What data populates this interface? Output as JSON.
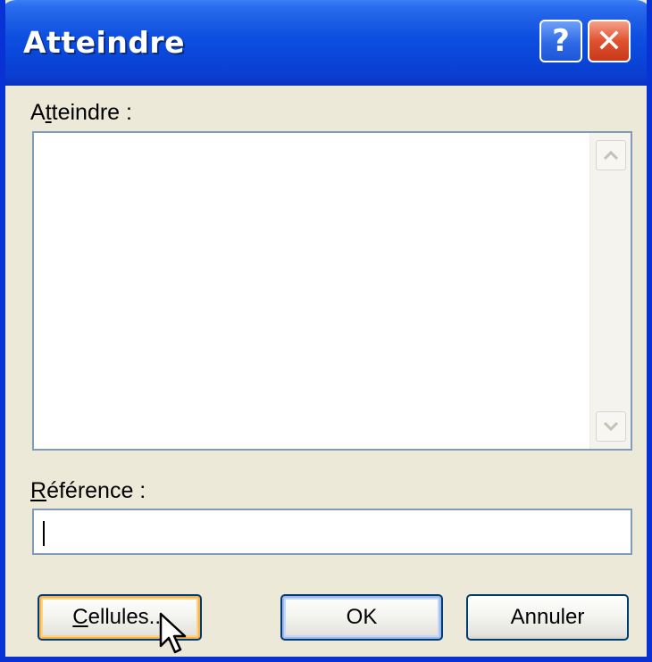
{
  "window": {
    "title": "Atteindre",
    "help_glyph": "?",
    "close_glyph": "✕"
  },
  "goto": {
    "label_prefix": "A",
    "label_accel": "t",
    "label_rest": "teindre :",
    "items": []
  },
  "reference": {
    "label_accel": "R",
    "label_rest": "éférence :",
    "value": ""
  },
  "buttons": {
    "cells_accel": "C",
    "cells_rest": "ellules...",
    "ok": "OK",
    "cancel": "Annuler"
  },
  "colors": {
    "titlebar": "#0c4ee0",
    "dialog_bg": "#ece9d8",
    "field_border": "#7f9db9",
    "focus_orange": "#f8b34a",
    "default_blue": "#9fb8ef",
    "close_red": "#e0522e"
  },
  "icons": {
    "help": "help-icon",
    "close": "close-icon",
    "scroll_up": "scroll-up-arrow-icon",
    "scroll_down": "scroll-down-arrow-icon",
    "pointer": "mouse-pointer-icon"
  }
}
